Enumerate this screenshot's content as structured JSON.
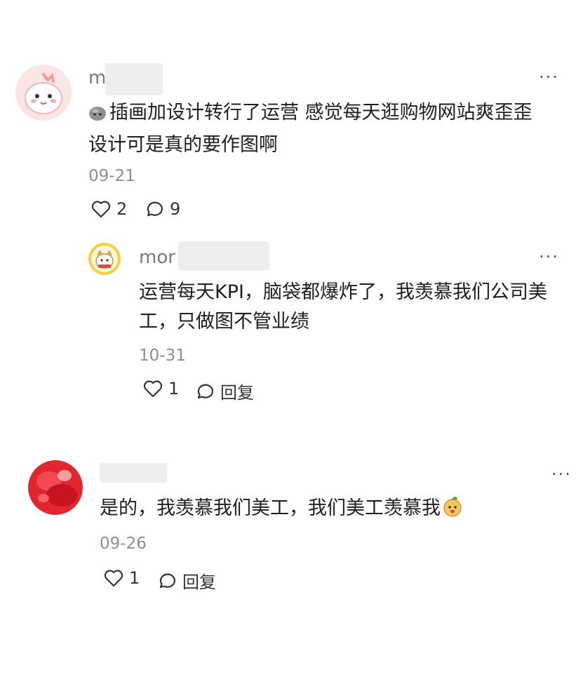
{
  "comments": [
    {
      "username": "m",
      "text_line1": "插画加设计转行了运营 感觉每天逛购物网站爽歪歪",
      "text_line2": "设计可是真的要作图啊",
      "date": "09-21",
      "likes": "2",
      "replies": "9",
      "leading_emoji": "rock-emoji",
      "avatar": "pink-cartoon-avatar"
    },
    {
      "username": "mor",
      "text_line1": "运营每天KPI，脑袋都爆炸了，我羡慕我们公司美",
      "text_line2": "工，只做图不管业绩",
      "date": "10-31",
      "likes": "1",
      "reply_label": "回复",
      "avatar": "cat-cartoon-avatar"
    },
    {
      "username": "",
      "text_line1": "是的，我羡慕我们美工，我们美工羡慕我",
      "date": "09-26",
      "likes": "1",
      "reply_label": "回复",
      "trailing_emoji": "orange-face-emoji",
      "avatar": "red-photo-avatar"
    }
  ],
  "more_label": "···",
  "colors": {
    "username": "#7a7a7a",
    "date": "#8e8e8e",
    "text": "#1e1e1e"
  }
}
